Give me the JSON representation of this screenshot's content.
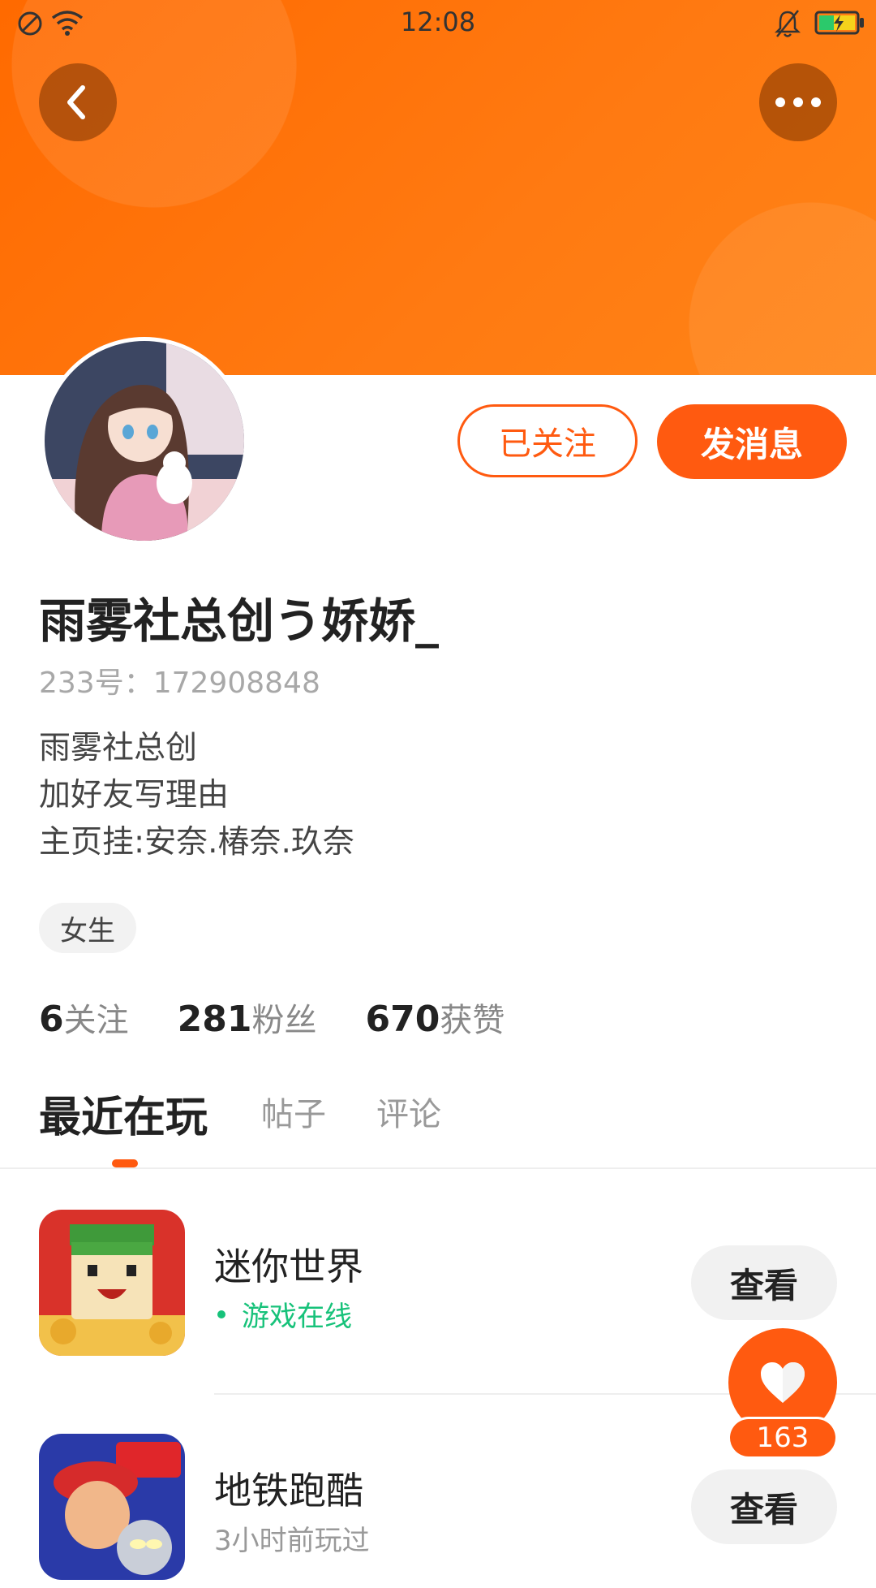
{
  "status_bar": {
    "time": "12:08"
  },
  "colors": {
    "brand": "#ff5a10",
    "header": "#ff7a12",
    "online": "#17c27a"
  },
  "header": {
    "back_icon": "chevron-left-icon",
    "more_icon": "more-horizontal-icon"
  },
  "profile": {
    "follow_label": "已关注",
    "message_label": "发消息",
    "username": "雨雾社总创う娇娇_",
    "user_id": "233号：172908848",
    "bio": [
      "雨雾社总创",
      "加好友写理由",
      "主页挂:安奈.椿奈.玖奈"
    ],
    "tag": "女生"
  },
  "stats": [
    {
      "value": "6",
      "label": "关注"
    },
    {
      "value": "281",
      "label": "粉丝"
    },
    {
      "value": "670",
      "label": "获赞"
    }
  ],
  "tabs": [
    "最近在玩",
    "帖子",
    "评论"
  ],
  "games": [
    {
      "title": "迷你世界",
      "status": "游戏在线",
      "online": true,
      "view_label": "查看"
    },
    {
      "title": "地铁跑酷",
      "status": "3小时前玩过",
      "online": false,
      "view_label": "查看"
    }
  ],
  "fab": {
    "icon": "heart-icon",
    "count": "163"
  }
}
